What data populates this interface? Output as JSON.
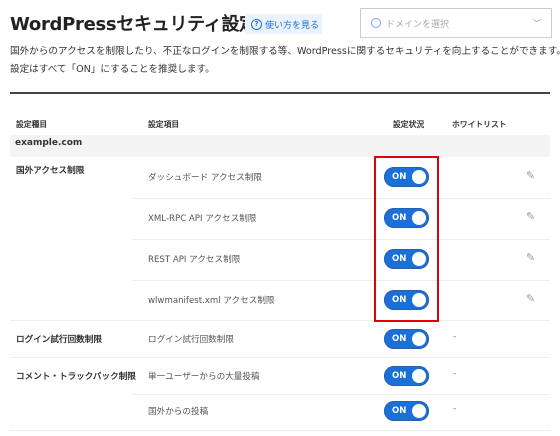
{
  "header": {
    "title": "WordPressセキュリティ設定",
    "help_label": "使い方を見る",
    "domain_placeholder": "ドメインを選択"
  },
  "description": [
    "国外からのアクセスを制限したり、不正なログインを制限する等、WordPressに関するセキュリティを向上することができます。",
    "設定はすべて「ON」にすることを推奨します。"
  ],
  "table": {
    "headers": [
      "設定種目",
      "設定項目",
      "設定状況",
      "ホワイトリスト"
    ],
    "domain": "example.com",
    "rows": [
      {
        "category": "国外アクセス制限",
        "item": "ダッシュボード アクセス制限",
        "status": "ON",
        "whitelist": "edit"
      },
      {
        "category": "",
        "item": "XML-RPC API アクセス制限",
        "status": "ON",
        "whitelist": "edit"
      },
      {
        "category": "",
        "item": "REST API アクセス制限",
        "status": "ON",
        "whitelist": "edit"
      },
      {
        "category": "",
        "item": "wlwmanifest.xml アクセス制限",
        "status": "ON",
        "whitelist": "edit"
      },
      {
        "category": "ログイン試行回数制限",
        "item": "ログイン試行回数制限",
        "status": "ON",
        "whitelist": "-"
      },
      {
        "category": "コメント・トラックバック制限",
        "item": "単一ユーザーからの大量投稿",
        "status": "ON",
        "whitelist": "-"
      },
      {
        "category": "",
        "item": "国外からの投稿",
        "status": "ON",
        "whitelist": "-"
      }
    ]
  },
  "colors": {
    "accent": "#1a6fd8",
    "highlight": "#e0000f"
  }
}
